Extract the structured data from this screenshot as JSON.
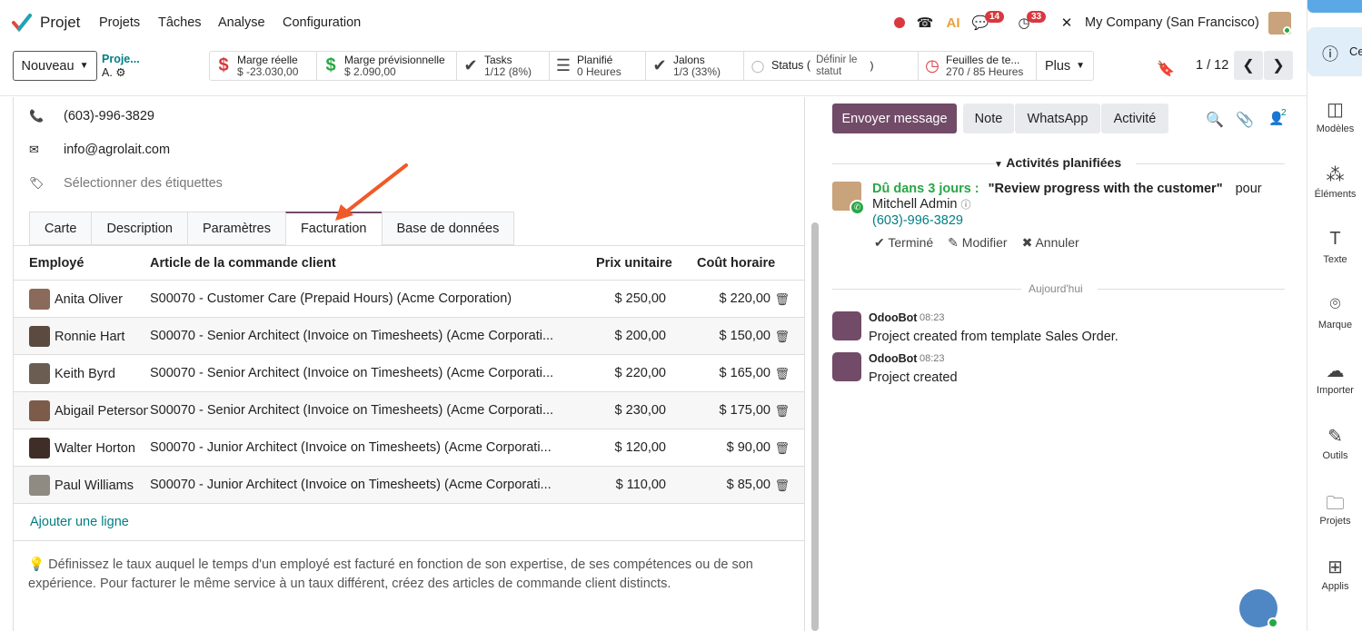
{
  "nav": {
    "app_name": "Projet",
    "menus": [
      "Projets",
      "Tâches",
      "Analyse",
      "Configuration"
    ],
    "badge_messages": "14",
    "badge_activities": "33",
    "company": "My Company (San Francisco)"
  },
  "control": {
    "new_button": "Nouveau",
    "breadcrumb_line1": "Proje...",
    "breadcrumb_line2": "A.",
    "stats": [
      {
        "label": "Marge réelle",
        "value": "$ -23.030,00",
        "icon": "dollar-icon"
      },
      {
        "label": "Marge prévisionnelle",
        "value": "$ 2.090,00",
        "icon": "dollar-icon"
      },
      {
        "label": "Tasks",
        "value": "1/12 (8%)",
        "icon": "check-icon"
      },
      {
        "label": "Planifié",
        "value": "0 Heures",
        "icon": "planning-icon"
      },
      {
        "label": "Jalons",
        "value": "1/3 (33%)",
        "icon": "check-icon"
      },
      {
        "label": "Status (",
        "value1": "Définir le",
        "value2": "statut",
        "close": ")",
        "icon": "status-dot-icon"
      },
      {
        "label": "Feuilles de te...",
        "value": "270 / 85 Heures",
        "icon": "clock-icon"
      }
    ],
    "more_button": "Plus",
    "pager": "1 / 12"
  },
  "form": {
    "phone": "(603)-996-3829",
    "email": "info@agrolait.com",
    "tags_placeholder": "Sélectionner des étiquettes",
    "tabs": [
      "Carte",
      "Description",
      "Paramètres",
      "Facturation",
      "Base de données"
    ],
    "active_tab": "Facturation",
    "columns": [
      "Employé",
      "Article de la commande client",
      "Prix unitaire",
      "Coût horaire"
    ],
    "rows": [
      {
        "employee": "Anita Oliver",
        "article": "S00070 - Customer Care (Prepaid Hours) (Acme Corporation)",
        "price": "$ 250,00",
        "cost": "$ 220,00",
        "color": "#8a6a5a"
      },
      {
        "employee": "Ronnie Hart",
        "article": "S00070 - Senior Architect (Invoice on Timesheets) (Acme Corporati...",
        "price": "$ 200,00",
        "cost": "$ 150,00",
        "color": "#5a4a3f"
      },
      {
        "employee": "Keith Byrd",
        "article": "S00070 - Senior Architect (Invoice on Timesheets) (Acme Corporati...",
        "price": "$ 220,00",
        "cost": "$ 165,00",
        "color": "#6b5d52"
      },
      {
        "employee": "Abigail Peterson",
        "article": "S00070 - Senior Architect (Invoice on Timesheets) (Acme Corporati...",
        "price": "$ 230,00",
        "cost": "$ 175,00",
        "color": "#7c5b4b"
      },
      {
        "employee": "Walter Horton",
        "article": "S00070 - Junior Architect (Invoice on Timesheets) (Acme Corporati...",
        "price": "$ 120,00",
        "cost": "$ 90,00",
        "color": "#3f2e27"
      },
      {
        "employee": "Paul Williams",
        "article": "S00070 - Junior Architect (Invoice on Timesheets) (Acme Corporati...",
        "price": "$ 110,00",
        "cost": "$ 85,00",
        "color": "#8f8a82"
      }
    ],
    "add_line": "Ajouter une ligne",
    "hint": "Définissez le taux auquel le temps d'un employé est facturé en fonction de son expertise, de ses compétences ou de son expérience. Pour facturer le même service à un taux différent, créez des articles de commande client distincts."
  },
  "chatter": {
    "send_message": "Envoyer message",
    "note": "Note",
    "whatsapp": "WhatsApp",
    "activity": "Activité",
    "followers_count": "2",
    "planned_title": "Activités planifiées",
    "due": "Dû dans 3 jours :",
    "activity_title": "\"Review progress with the customer\"",
    "for": "pour",
    "assignee": "Mitchell Admin",
    "activity_phone": "(603)-996-3829",
    "done": "Terminé",
    "edit": "Modifier",
    "cancel": "Annuler",
    "today": "Aujourd'hui",
    "messages": [
      {
        "author": "OdooBot",
        "time": "08:23",
        "body": "Project created from template Sales Order."
      },
      {
        "author": "OdooBot",
        "time": "08:23",
        "body": "Project created"
      }
    ]
  },
  "sidebar": {
    "top_label": "Ce",
    "items": [
      "Modèles",
      "Éléments",
      "Texte",
      "Marque",
      "Importer",
      "Outils",
      "Projets",
      "Applis"
    ]
  }
}
